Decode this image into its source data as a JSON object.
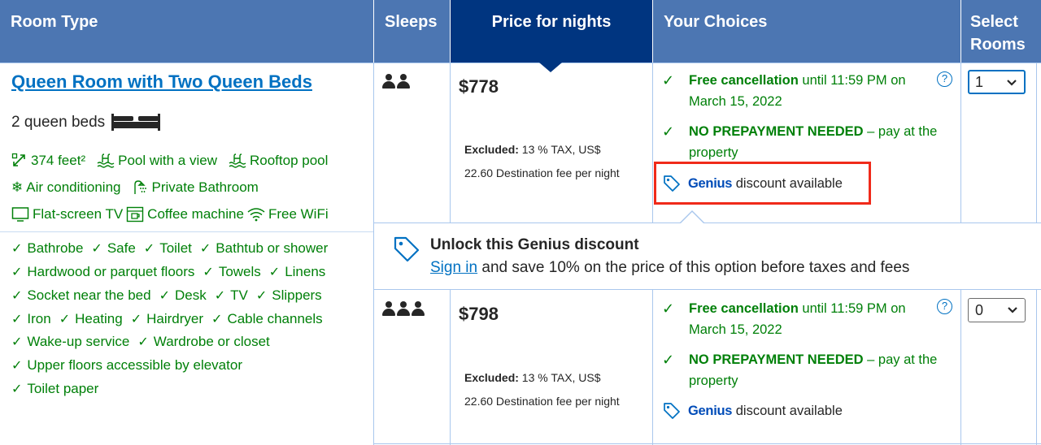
{
  "header": {
    "room_type": "Room Type",
    "sleeps": "Sleeps",
    "price": "Price for nights",
    "choices": "Your Choices",
    "select_line1": "Select",
    "select_line2": "Rooms"
  },
  "room": {
    "title": "Queen Room with Two Queen Beds",
    "beds": "2 queen beds",
    "facilities": [
      [
        "374 feet²",
        "Pool with a view",
        "Rooftop pool"
      ],
      [
        "Air conditioning",
        "Private Bathroom"
      ],
      [
        "Flat-screen TV",
        "Coffee machine",
        "Free WiFi"
      ]
    ],
    "amenities": [
      [
        "Bathrobe",
        "Safe",
        "Toilet",
        "Bathtub or shower"
      ],
      [
        "Hardwood or parquet floors",
        "Towels",
        "Linens"
      ],
      [
        "Socket near the bed",
        "Desk",
        "TV",
        "Slippers"
      ],
      [
        "Iron",
        "Heating",
        "Hairdryer",
        "Cable channels"
      ],
      [
        "Wake-up service",
        "Wardrobe or closet"
      ],
      [
        "Upper floors accessible by elevator"
      ],
      [
        "Toilet paper"
      ]
    ]
  },
  "options": [
    {
      "sleeps": 2,
      "price": "$778",
      "tax_line1_bold": "Excluded:",
      "tax_line1_rest": " 13 % TAX, US$",
      "tax_line2": "22.60 Destination fee per night",
      "cancel_bold": "Free cancellation",
      "cancel_rest": " until 11:59 PM on March 15, 2022",
      "prepay_bold": "NO PREPAYMENT NEEDED",
      "prepay_rest": " – pay at the property",
      "genius_brand": "Genius",
      "genius_text": " discount available",
      "select_value": "1"
    },
    {
      "sleeps": 3,
      "price": "$798",
      "tax_line1_bold": "Excluded:",
      "tax_line1_rest": " 13 % TAX, US$",
      "tax_line2": "22.60 Destination fee per night",
      "cancel_bold": "Free cancellation",
      "cancel_rest": " until 11:59 PM on March 15, 2022",
      "prepay_bold": "NO PREPAYMENT NEEDED",
      "prepay_rest": " – pay at the property",
      "genius_brand": "Genius",
      "genius_text": " discount available",
      "select_value": "0"
    }
  ],
  "popup": {
    "title": "Unlock this Genius discount",
    "link": "Sign in",
    "rest": " and save 10% on the price of this option before taxes and fees"
  },
  "help_symbol": "?",
  "colors": {
    "header": "#4c76b2",
    "header_active": "#003580",
    "link": "#0071c2",
    "green": "#008009",
    "highlight": "#f02a1a"
  }
}
